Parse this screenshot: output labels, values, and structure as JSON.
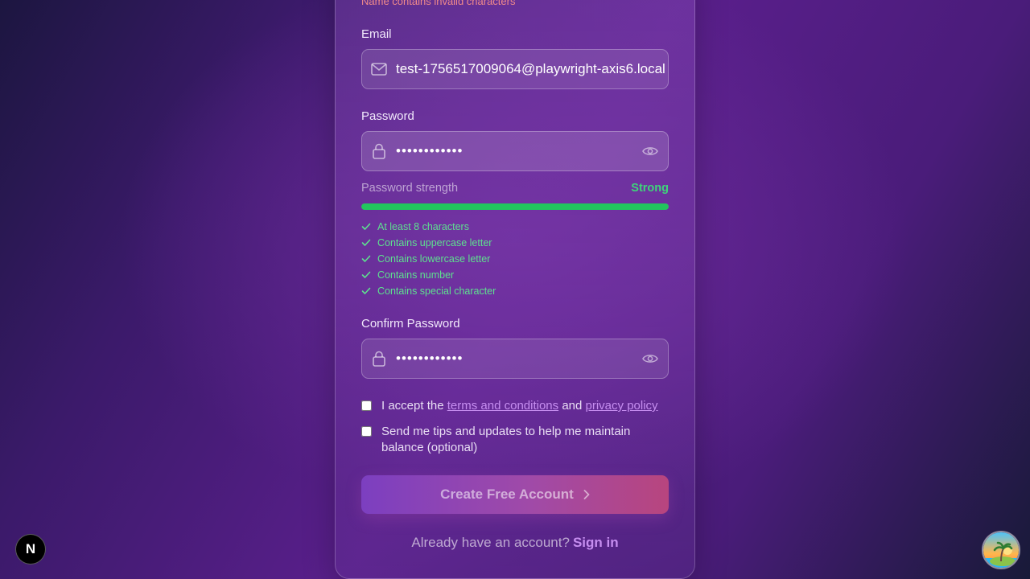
{
  "form": {
    "name_error": "Name contains invalid characters",
    "email_label": "Email",
    "email_value": "test-1756517009064@playwright-axis6.local",
    "password_label": "Password",
    "password_value": "••••••••••••",
    "strength_label": "Password strength",
    "strength_value": "Strong",
    "strength_level": 1.0,
    "requirements": [
      "At least 8 characters",
      "Contains uppercase letter",
      "Contains lowercase letter",
      "Contains number",
      "Contains special character"
    ],
    "confirm_label": "Confirm Password",
    "confirm_value": "••••••••••••",
    "terms_prefix": "I accept the",
    "terms_link": "terms and conditions",
    "terms_and": "and",
    "privacy_link": "privacy policy",
    "updates_text": "Send me tips and updates to help me maintain balance (optional)",
    "submit_label": "Create Free Account",
    "signin_prompt": "Already have an account?",
    "signin_link": "Sign in"
  },
  "badge": {
    "letter": "N"
  },
  "colors": {
    "accent": "#c68ef0",
    "success": "#22c55e",
    "error": "#f08a8a"
  }
}
